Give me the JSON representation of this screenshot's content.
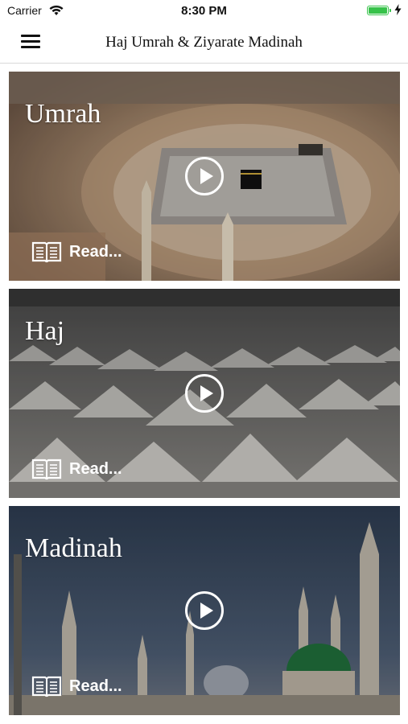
{
  "status_bar": {
    "carrier": "Carrier",
    "time": "8:30 PM"
  },
  "nav": {
    "title": "Haj Umrah & Ziyarate Madinah"
  },
  "cards": [
    {
      "title": "Umrah",
      "read_label": "Read..."
    },
    {
      "title": "Haj",
      "read_label": "Read..."
    },
    {
      "title": "Madinah",
      "read_label": "Read..."
    }
  ],
  "icons": {
    "menu": "hamburger-icon",
    "play": "play-icon",
    "read": "book-icon",
    "wifi": "wifi-icon",
    "battery": "battery-icon",
    "charging": "bolt-icon"
  },
  "colors": {
    "battery": "#37c24a",
    "text_overlay": "#ffffff"
  }
}
